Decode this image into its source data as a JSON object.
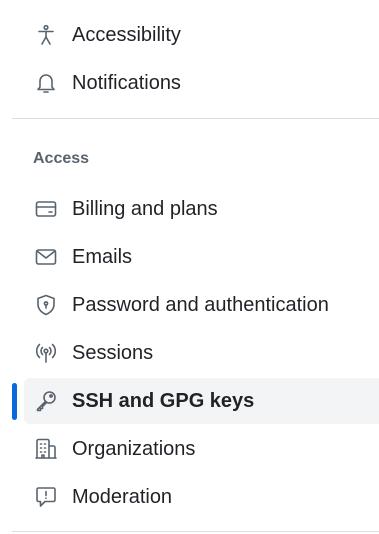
{
  "sidebar": {
    "top_items": [
      {
        "label": "Accessibility",
        "icon": "accessibility-icon"
      },
      {
        "label": "Notifications",
        "icon": "bell-icon"
      }
    ],
    "access_section": {
      "heading": "Access",
      "items": [
        {
          "label": "Billing and plans",
          "icon": "credit-card-icon"
        },
        {
          "label": "Emails",
          "icon": "mail-icon"
        },
        {
          "label": "Password and authentication",
          "icon": "shield-lock-icon"
        },
        {
          "label": "Sessions",
          "icon": "broadcast-icon"
        },
        {
          "label": "SSH and GPG keys",
          "icon": "key-icon",
          "active": true
        },
        {
          "label": "Organizations",
          "icon": "organization-icon"
        },
        {
          "label": "Moderation",
          "icon": "report-icon"
        }
      ]
    }
  },
  "colors": {
    "accent": "#0969da",
    "active_background": "#f3f4f6",
    "text": "#1f2328",
    "muted": "#59636e",
    "divider": "#d8dee4"
  }
}
